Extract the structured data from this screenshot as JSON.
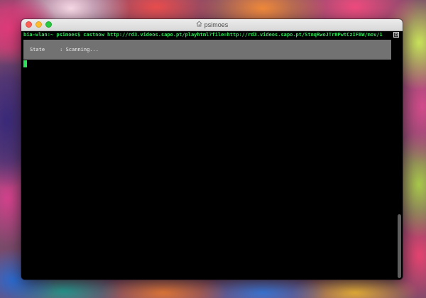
{
  "window": {
    "title": "psimoes",
    "title_icon": "home-icon"
  },
  "terminal": {
    "prompt": "bia-wlan:~ psimoes$ ",
    "command": "castnow http://rd3.videos.sapo.pt/playhtml?file=http://rd3.videos.sapo.pt/StnqRwoJTrHPwtCzIFBW/mov/1",
    "status_label": "State",
    "status_separator": ":",
    "status_value": "Scanning...",
    "prompt_color": "#2fe05a",
    "panel_color": "#727272"
  }
}
